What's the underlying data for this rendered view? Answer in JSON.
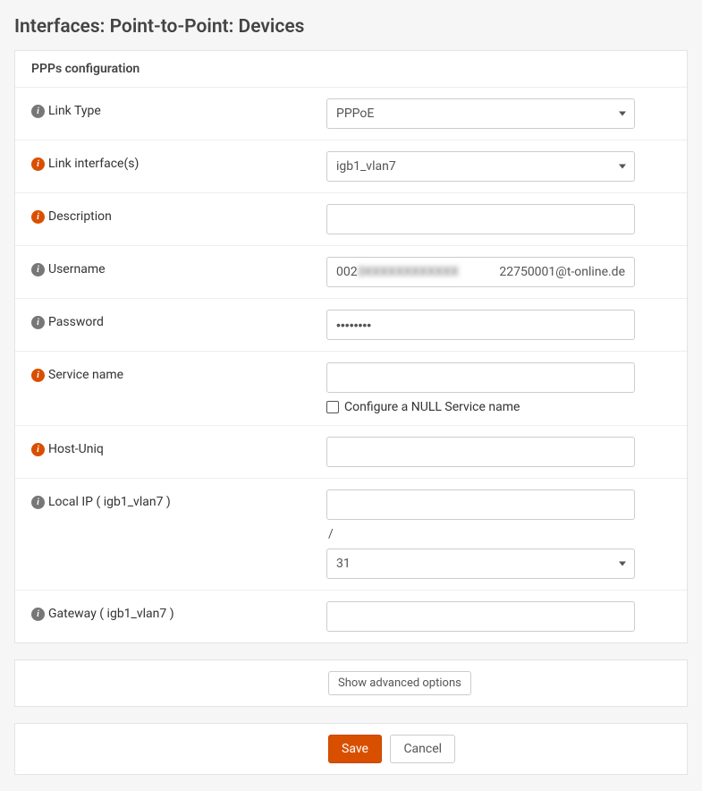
{
  "page_title": "Interfaces: Point-to-Point: Devices",
  "panel": {
    "header": "PPPs configuration",
    "fields": {
      "link_type": {
        "label": "Link Type",
        "value": "PPPoE",
        "info": "grey"
      },
      "link_interfaces": {
        "label": "Link interface(s)",
        "value": "igb1_vlan7",
        "info": "orange"
      },
      "description": {
        "label": "Description",
        "value": "",
        "info": "orange"
      },
      "username": {
        "label": "Username",
        "prefix": "002",
        "redacted_middle": "3XXXXXXXXXXXX",
        "suffix": "22750001@t-online.de",
        "info": "grey"
      },
      "password": {
        "label": "Password",
        "value": "••••••••",
        "info": "grey"
      },
      "service_name": {
        "label": "Service name",
        "value": "",
        "checkbox_label": "Configure a NULL Service name",
        "info": "orange"
      },
      "host_uniq": {
        "label": "Host-Uniq",
        "value": "",
        "info": "orange"
      },
      "local_ip": {
        "label": "Local IP ( igb1_vlan7 )",
        "value": "",
        "separator": "/",
        "subnet": "31",
        "info": "grey"
      },
      "gateway": {
        "label": "Gateway ( igb1_vlan7 )",
        "value": "",
        "info": "grey"
      }
    }
  },
  "actions": {
    "show_advanced": "Show advanced options",
    "save": "Save",
    "cancel": "Cancel"
  }
}
